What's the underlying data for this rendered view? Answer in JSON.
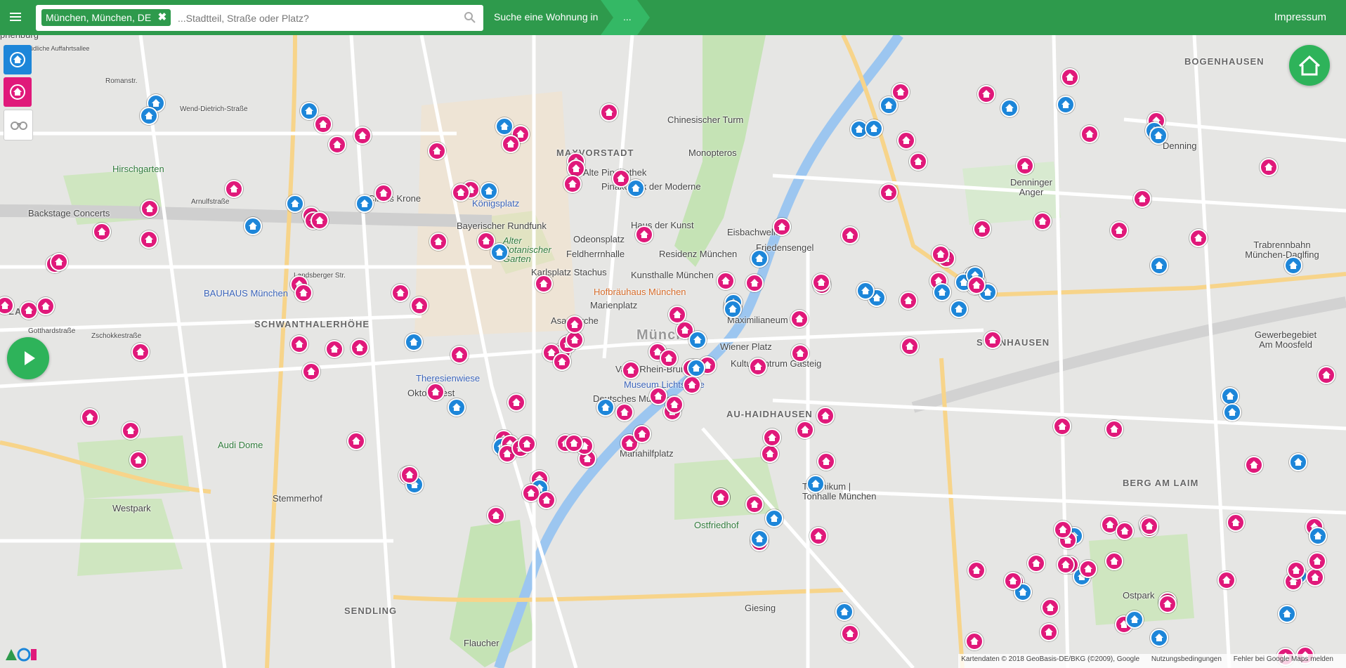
{
  "header": {
    "location_tag": "München, München, DE",
    "search_placeholder": "...Stadtteil, Straße oder Platz?",
    "search_cta": "Suche eine Wohnung in",
    "dots": "...",
    "impressum": "Impressum"
  },
  "icons": {
    "menu": "hamburger-menu-icon",
    "tag_remove": "close-icon",
    "search": "magnifier-icon",
    "home_filter": "house-icon",
    "binoculars": "binoculars-icon",
    "play": "play-icon"
  },
  "colors": {
    "brand_green": "#2e9a4c",
    "pink_pin": "#e0197a",
    "blue_pin": "#1d86d9"
  },
  "map": {
    "labels": [
      "phenburg",
      "Südliche Auffahrtsallee",
      "Romanstr.",
      "Wend-Dietrich-Straße",
      "Hirschgarten",
      "Backstage Concerts",
      "Arnulfstraße",
      "Landsberger Str.",
      "BAUHAUS München",
      "LAIM",
      "Gotthardstraße",
      "Zschokkestraße",
      "SCHWANTHALERHÖHE",
      "Audi Dome",
      "Westpark",
      "Stemmerhof",
      "SENDLING",
      "Flaucher",
      "Circus Krone",
      "Bayerischer Rundfunk",
      "Königsplatz",
      "Alter Botanischer Garten",
      "Karlsplatz Stachus",
      "Theresienwiese",
      "Oktoberfest",
      "MAXVORSTADT",
      "Alte Pinakothek",
      "Pinakothek der Moderne",
      "Chinesischer Turm",
      "Monopteros",
      "Haus der Kunst",
      "Eisbachwelle",
      "Odeonsplatz",
      "Feldherrnhalle",
      "Residenz München",
      "Kunsthalle München",
      "Hofbräuhaus München",
      "Marienplatz",
      "Asamkirche",
      "München",
      "Maximilianeum",
      "Wiener Platz",
      "Vater-Rhein-Brunnen",
      "Kulturzentrum Gasteig",
      "Deutsches Museum",
      "Museum Lichtspiele",
      "AU-HAIDHAUSEN",
      "Mariahilfplatz",
      "Ostfriedhof",
      "Technikum | Tonhalle München",
      "Giesing",
      "BOGENHAUSEN",
      "Denning",
      "Denninger Anger",
      "STEINHAUSEN",
      "Trabrennbahn München-Daglfing",
      "Gewerbegebiet Am Moosfeld",
      "BERG AM LAIM",
      "Ostpark",
      "Friedensengel"
    ],
    "attribution": [
      "Kartendaten © 2018 GeoBasis-DE/BKG (©2009), Google",
      "Nutzungsbedingungen",
      "Fehler bei Google Maps melden"
    ]
  }
}
